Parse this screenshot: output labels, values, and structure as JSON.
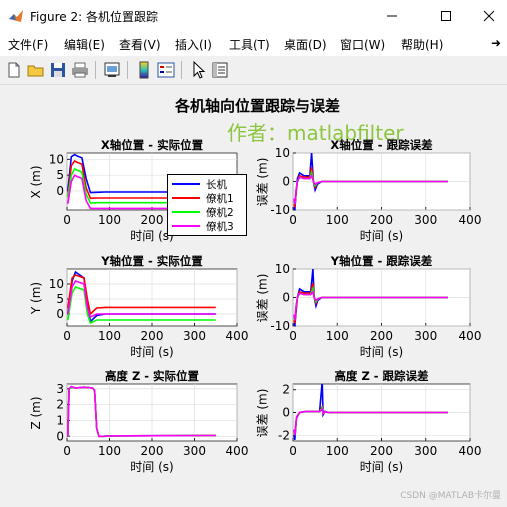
{
  "window": {
    "title": "Figure 2: 各机位置跟踪",
    "icon": "matlab-icon"
  },
  "menubar": [
    {
      "label": "文件(F)",
      "key": "file"
    },
    {
      "label": "编辑(E)",
      "key": "edit"
    },
    {
      "label": "查看(V)",
      "key": "view"
    },
    {
      "label": "插入(I)",
      "key": "insert"
    },
    {
      "label": "工具(T)",
      "key": "tools"
    },
    {
      "label": "桌面(D)",
      "key": "desktop"
    },
    {
      "label": "窗口(W)",
      "key": "window"
    },
    {
      "label": "帮助(H)",
      "key": "help"
    }
  ],
  "toolbar": [
    "new-figure-icon",
    "open-file-icon",
    "save-icon",
    "print-icon",
    "link-plot-icon",
    "insert-colorbar-icon",
    "insert-legend-icon",
    "pointer-icon",
    "property-inspector-icon"
  ],
  "figure": {
    "title": "各机轴向位置跟踪与误差",
    "watermark": "作者：matlabfilter",
    "footer": "CSDN @MATLAB卡尔曼"
  },
  "colors": {
    "长机": "#0000ff",
    "僚机1": "#ff0000",
    "僚机2": "#00ff00",
    "僚机3": "#ff00ff"
  },
  "legend": [
    "长机",
    "僚机1",
    "僚机2",
    "僚机3"
  ],
  "chart_data": [
    {
      "type": "line",
      "title": "X轴位置 - 实际位置",
      "xlabel": "时间 (s)",
      "ylabel": "X (m)",
      "xlim": [
        0,
        400
      ],
      "ylim": [
        -6,
        12
      ],
      "xticks": [
        "0",
        "100",
        "200"
      ],
      "yticks": [
        "0",
        "5",
        "10"
      ],
      "grid": true,
      "series": [
        {
          "name": "长机",
          "x": [
            2,
            10,
            18,
            25,
            35,
            45,
            55,
            70,
            90,
            150,
            350
          ],
          "y": [
            0,
            10.8,
            11.5,
            11,
            10.5,
            4,
            -0.5,
            -0.4,
            -0.3,
            -0.3,
            -0.3
          ]
        },
        {
          "name": "僚机1",
          "x": [
            2,
            10,
            18,
            25,
            35,
            45,
            55,
            70,
            90,
            150,
            350
          ],
          "y": [
            -2,
            8,
            9.5,
            9,
            8.5,
            1,
            -2.3,
            -2.2,
            -2.2,
            -2.2,
            -2.2
          ]
        },
        {
          "name": "僚机2",
          "x": [
            2,
            10,
            18,
            25,
            35,
            45,
            55,
            70,
            90,
            150,
            350
          ],
          "y": [
            -2,
            5,
            7,
            6.5,
            6,
            -1,
            -3.8,
            -3.7,
            -3.7,
            -3.7,
            -3.7
          ]
        },
        {
          "name": "僚机3",
          "x": [
            2,
            10,
            18,
            25,
            35,
            45,
            55,
            70,
            90,
            150,
            350
          ],
          "y": [
            -4,
            3,
            5,
            4.5,
            4,
            -3,
            -5.5,
            -5.5,
            -5.5,
            -5.5,
            -5.5
          ]
        }
      ]
    },
    {
      "type": "line",
      "title": "X轴位置 - 跟踪误差",
      "xlabel": "时间 (s)",
      "ylabel": "误差 (m)",
      "xlim": [
        0,
        400
      ],
      "ylim": [
        -10,
        10
      ],
      "xticks": [
        "0",
        "100",
        "200",
        "300",
        "400"
      ],
      "yticks": [
        "-10",
        "0",
        "10"
      ],
      "grid": true,
      "series": [
        {
          "name": "长机",
          "x": [
            2,
            4,
            7,
            10,
            15,
            25,
            38,
            42,
            46,
            50,
            55,
            65,
            80,
            350
          ],
          "y": [
            -9,
            -10,
            -4,
            1,
            3,
            2,
            2,
            10,
            0,
            -3,
            -1,
            0,
            0,
            0
          ]
        },
        {
          "name": "僚机1",
          "x": [
            2,
            4,
            7,
            10,
            15,
            25,
            38,
            42,
            46,
            50,
            55,
            65,
            80,
            350
          ],
          "y": [
            -8,
            -9,
            -4,
            0,
            2,
            1.5,
            1.5,
            5,
            0,
            -2,
            -0.5,
            0,
            0,
            0
          ]
        },
        {
          "name": "僚机2",
          "x": [
            2,
            4,
            7,
            10,
            15,
            25,
            38,
            42,
            46,
            50,
            55,
            65,
            80,
            350
          ],
          "y": [
            -7,
            -8,
            -3,
            0,
            1.5,
            1,
            1,
            3,
            0,
            -1.5,
            -0.5,
            0,
            0,
            0
          ]
        },
        {
          "name": "僚机3",
          "x": [
            2,
            4,
            7,
            10,
            15,
            25,
            38,
            42,
            46,
            50,
            55,
            65,
            80,
            350
          ],
          "y": [
            -6,
            -8,
            -3,
            0,
            1.5,
            1,
            1,
            2,
            0,
            -1,
            -0.5,
            0,
            0,
            0
          ]
        }
      ]
    },
    {
      "type": "line",
      "title": "Y轴位置 - 实际位置",
      "xlabel": "时间 (s)",
      "ylabel": "Y (m)",
      "xlim": [
        0,
        400
      ],
      "ylim": [
        -4,
        15
      ],
      "xticks": [
        "0",
        "100",
        "200",
        "300",
        "400"
      ],
      "yticks": [
        "0",
        "5",
        "10"
      ],
      "grid": true,
      "series": [
        {
          "name": "长机",
          "x": [
            2,
            12,
            20,
            30,
            40,
            48,
            55,
            70,
            90,
            150,
            350
          ],
          "y": [
            0,
            11,
            14,
            13,
            12,
            3,
            -2.5,
            -0.5,
            0,
            0,
            0
          ]
        },
        {
          "name": "僚机1",
          "x": [
            2,
            12,
            20,
            30,
            40,
            48,
            55,
            70,
            90,
            150,
            350
          ],
          "y": [
            2,
            12,
            13,
            12.5,
            12,
            5,
            0,
            2,
            2.2,
            2.2,
            2.2
          ]
        },
        {
          "name": "僚机2",
          "x": [
            2,
            12,
            20,
            30,
            40,
            48,
            55,
            70,
            90,
            150,
            350
          ],
          "y": [
            -2,
            7,
            9,
            8.5,
            8,
            0,
            -3,
            -2,
            -2,
            -2,
            -2
          ]
        },
        {
          "name": "僚机3",
          "x": [
            2,
            12,
            20,
            30,
            40,
            48,
            55,
            70,
            90,
            150,
            350
          ],
          "y": [
            0,
            9,
            11,
            10.5,
            10,
            2,
            -1,
            0,
            0,
            0,
            0
          ]
        }
      ]
    },
    {
      "type": "line",
      "title": "Y轴位置 - 跟踪误差",
      "xlabel": "时间 (s)",
      "ylabel": "误差 (m)",
      "xlim": [
        0,
        400
      ],
      "ylim": [
        -10,
        10
      ],
      "xticks": [
        "0",
        "100",
        "200",
        "300",
        "400"
      ],
      "yticks": [
        "-10",
        "0",
        "10"
      ],
      "grid": true,
      "series": [
        {
          "name": "长机",
          "x": [
            2,
            4,
            7,
            10,
            15,
            25,
            40,
            45,
            48,
            52,
            56,
            65,
            80,
            350
          ],
          "y": [
            -9,
            -10,
            -5,
            0,
            3,
            2,
            2,
            10,
            0,
            -3,
            -1,
            0,
            0,
            0
          ]
        },
        {
          "name": "僚机1",
          "x": [
            2,
            4,
            7,
            10,
            15,
            25,
            40,
            45,
            48,
            52,
            56,
            65,
            80,
            350
          ],
          "y": [
            -8,
            -9,
            -4,
            0,
            2,
            1.5,
            1.5,
            5,
            0,
            -2,
            -0.5,
            0,
            0,
            0
          ]
        },
        {
          "name": "僚机2",
          "x": [
            2,
            4,
            7,
            10,
            15,
            25,
            40,
            45,
            48,
            52,
            56,
            65,
            80,
            350
          ],
          "y": [
            -7,
            -8,
            -3,
            0,
            1.5,
            1,
            1,
            3,
            0,
            -1.5,
            -0.5,
            0,
            0,
            0
          ]
        },
        {
          "name": "僚机3",
          "x": [
            2,
            4,
            7,
            10,
            15,
            25,
            40,
            45,
            48,
            52,
            56,
            65,
            80,
            350
          ],
          "y": [
            -6,
            -8,
            -3,
            0,
            1.5,
            1,
            1,
            2,
            0,
            -1,
            -0.5,
            0,
            0,
            0
          ]
        }
      ]
    },
    {
      "type": "line",
      "title": "高度 Z - 实际位置",
      "xlabel": "时间 (s)",
      "ylabel": "Z (m)",
      "xlim": [
        0,
        400
      ],
      "ylim": [
        -0.3,
        3.3
      ],
      "xticks": [
        "0",
        "100",
        "200",
        "300",
        "400"
      ],
      "yticks": [
        "0",
        "1",
        "2",
        "3"
      ],
      "grid": true,
      "series": [
        {
          "name": "长机",
          "x": [
            2,
            5,
            10,
            20,
            40,
            60,
            65,
            70,
            75,
            85,
            100,
            350
          ],
          "y": [
            0,
            3,
            3.1,
            3.05,
            3.1,
            3.05,
            2.9,
            0.5,
            0,
            0,
            0.02,
            0.05
          ]
        },
        {
          "name": "僚机1",
          "x": [
            2,
            5,
            10,
            20,
            40,
            60,
            65,
            70,
            75,
            85,
            100,
            350
          ],
          "y": [
            0,
            3,
            3.1,
            3.05,
            3.1,
            3.05,
            2.9,
            0.5,
            0,
            0,
            0.02,
            0.05
          ]
        },
        {
          "name": "僚机2",
          "x": [
            2,
            5,
            10,
            20,
            40,
            60,
            65,
            70,
            75,
            85,
            100,
            350
          ],
          "y": [
            0,
            3,
            3.1,
            3.05,
            3.1,
            3.05,
            2.9,
            0.5,
            0,
            0,
            0.02,
            0.05
          ]
        },
        {
          "name": "僚机3",
          "x": [
            2,
            5,
            10,
            20,
            40,
            60,
            65,
            70,
            75,
            85,
            100,
            350
          ],
          "y": [
            0,
            3,
            3.15,
            3.05,
            3.1,
            3.05,
            2.9,
            0.5,
            0,
            0,
            0.02,
            0.05
          ]
        }
      ]
    },
    {
      "type": "line",
      "title": "高度 Z - 跟踪误差",
      "xlabel": "时间 (s)",
      "ylabel": "误差 (m)",
      "xlim": [
        0,
        400
      ],
      "ylim": [
        -2.5,
        2.5
      ],
      "xticks": [
        "0",
        "100",
        "200",
        "300",
        "400"
      ],
      "yticks": [
        "-2",
        "0",
        "2"
      ],
      "grid": true,
      "series": [
        {
          "name": "长机",
          "x": [
            2,
            4,
            8,
            15,
            30,
            60,
            66,
            68,
            72,
            80,
            350
          ],
          "y": [
            -2,
            -2.4,
            -0.5,
            0,
            0.1,
            0.1,
            2.7,
            -0.2,
            0.1,
            0,
            0
          ]
        },
        {
          "name": "僚机1",
          "x": [
            2,
            4,
            8,
            15,
            30,
            60,
            66,
            68,
            72,
            80,
            350
          ],
          "y": [
            -1.5,
            -2,
            -0.4,
            0,
            0.1,
            0.1,
            0.5,
            -0.1,
            0.05,
            0,
            0
          ]
        },
        {
          "name": "僚机2",
          "x": [
            2,
            4,
            8,
            15,
            30,
            60,
            66,
            68,
            72,
            80,
            350
          ],
          "y": [
            -1.5,
            -2,
            -0.4,
            0,
            0.1,
            0.1,
            0.4,
            -0.1,
            0.05,
            0,
            0
          ]
        },
        {
          "name": "僚机3",
          "x": [
            2,
            4,
            8,
            15,
            30,
            60,
            66,
            68,
            72,
            80,
            350
          ],
          "y": [
            -1.5,
            -2,
            -0.4,
            0,
            0.1,
            0.1,
            0.3,
            -0.1,
            0.05,
            0,
            0
          ]
        }
      ]
    }
  ]
}
